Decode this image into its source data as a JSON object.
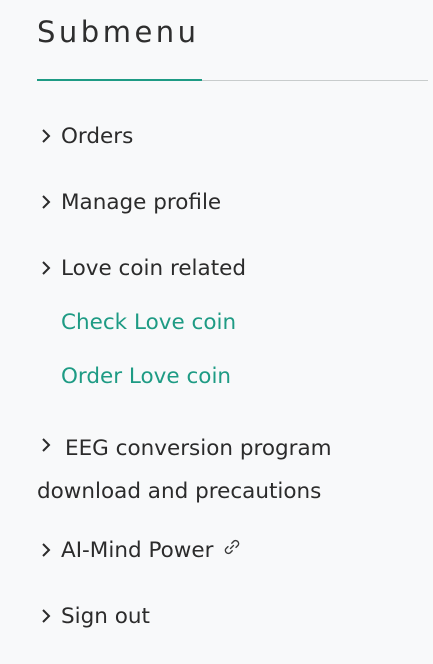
{
  "submenu": {
    "title": "Submenu",
    "items": [
      {
        "label": "Orders"
      },
      {
        "label": "Manage profile"
      },
      {
        "label": "Love coin related"
      },
      {
        "label": "EEG conversion program download and precautions"
      },
      {
        "label": "AI-Mind Power"
      },
      {
        "label": "Sign out"
      }
    ],
    "love_coin_subitems": [
      {
        "label": "Check Love coin"
      },
      {
        "label": "Order Love coin"
      }
    ]
  },
  "icons": {
    "chevron": "chevron-right-icon",
    "external": "link-icon"
  },
  "colors": {
    "accent": "#1e9b84",
    "text": "#2b2b2b",
    "background": "#f8f9fa"
  }
}
